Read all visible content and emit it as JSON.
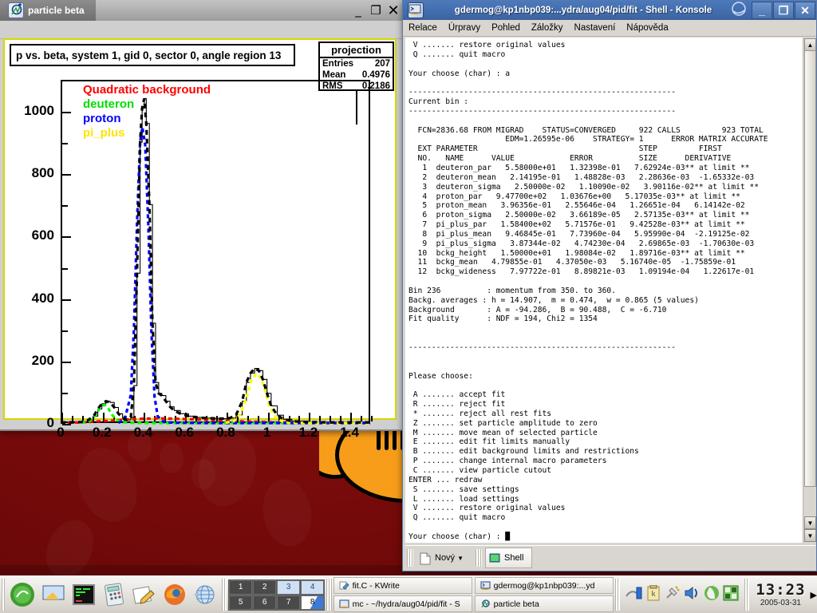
{
  "desktop": {
    "bg_color": "#7a0b0b",
    "accent_color": "#f79d1a"
  },
  "root_window": {
    "tab_label": "particle beta",
    "app_icon": "root-icon",
    "buttons": {
      "minimize": "_",
      "maximize": "❐",
      "close": "✕"
    }
  },
  "chart_data": {
    "type": "line",
    "title": "p vs. beta, system 1, gid 0, sector 0, angle region 13",
    "xlabel": "",
    "ylabel": "",
    "xlim": [
      0,
      1.5
    ],
    "ylim": [
      0,
      1100
    ],
    "xticks": [
      0,
      0.2,
      0.4,
      0.6,
      0.8,
      1,
      1.2,
      1.4
    ],
    "xtick_labels": [
      "0",
      "0.2",
      "0.4",
      "0.6",
      "0.8",
      "1",
      "1.2",
      "1.4"
    ],
    "yticks": [
      0,
      200,
      400,
      600,
      800,
      1000
    ],
    "ytick_labels": [
      "0",
      "200",
      "400",
      "600",
      "800",
      "1000"
    ],
    "grid": false,
    "legend_position": "top-left",
    "legend": [
      {
        "label": "Quadratic background",
        "color": "#ff0000"
      },
      {
        "label": "deuteron",
        "color": "#00ff00"
      },
      {
        "label": "proton",
        "color": "#0000ff"
      },
      {
        "label": "pi_plus",
        "color": "#ffff00"
      }
    ],
    "series": [
      {
        "name": "data",
        "color": "#000000",
        "x": [
          0.0,
          0.05,
          0.1,
          0.13,
          0.16,
          0.18,
          0.2,
          0.22,
          0.24,
          0.26,
          0.28,
          0.3,
          0.32,
          0.34,
          0.355,
          0.37,
          0.385,
          0.395,
          0.405,
          0.415,
          0.43,
          0.445,
          0.46,
          0.475,
          0.49,
          0.51,
          0.53,
          0.55,
          0.58,
          0.62,
          0.66,
          0.7,
          0.74,
          0.78,
          0.82,
          0.85,
          0.88,
          0.9,
          0.92,
          0.94,
          0.96,
          0.98,
          1.0,
          1.02,
          1.05,
          1.08,
          1.12,
          1.2,
          1.3,
          1.4,
          1.5
        ],
        "y": [
          2,
          2,
          3,
          8,
          22,
          45,
          62,
          70,
          66,
          50,
          30,
          16,
          10,
          18,
          120,
          480,
          900,
          1010,
          1040,
          960,
          700,
          320,
          130,
          95,
          88,
          70,
          52,
          40,
          30,
          22,
          18,
          16,
          15,
          14,
          16,
          26,
          70,
          130,
          160,
          175,
          168,
          140,
          95,
          55,
          25,
          12,
          6,
          3,
          2,
          2,
          2
        ]
      },
      {
        "name": "Quadratic background",
        "color": "#ff0000",
        "x": [
          0.0,
          0.1,
          0.2,
          0.3,
          0.4,
          0.48,
          0.55,
          0.65,
          0.75,
          0.85,
          0.95,
          1.05,
          1.15,
          1.3,
          1.5
        ],
        "y": [
          1,
          2,
          6,
          10,
          14,
          15,
          14,
          12,
          9,
          6,
          4,
          2,
          1,
          1,
          1
        ]
      },
      {
        "name": "deuteron",
        "color": "#00ff00",
        "x": [
          0.1,
          0.14,
          0.17,
          0.19,
          0.21,
          0.214,
          0.23,
          0.25,
          0.27,
          0.3,
          0.34,
          0.4,
          0.6,
          1.0,
          1.5
        ],
        "y": [
          1,
          6,
          26,
          48,
          58,
          58,
          48,
          26,
          10,
          3,
          1,
          0,
          0,
          0,
          0
        ]
      },
      {
        "name": "proton",
        "color": "#0000ff",
        "x": [
          0.28,
          0.31,
          0.34,
          0.355,
          0.37,
          0.385,
          0.396,
          0.41,
          0.425,
          0.44,
          0.455,
          0.47,
          0.5,
          0.55,
          0.7,
          1.0,
          1.5
        ],
        "y": [
          1,
          10,
          90,
          300,
          640,
          900,
          948,
          890,
          630,
          290,
          85,
          22,
          3,
          1,
          0,
          0,
          0
        ]
      },
      {
        "name": "pi_plus",
        "color": "#ffff00",
        "x": [
          0.8,
          0.84,
          0.87,
          0.9,
          0.925,
          0.947,
          0.97,
          0.99,
          1.01,
          1.04,
          1.07,
          1.1,
          1.2,
          1.5
        ],
        "y": [
          1,
          6,
          28,
          80,
          138,
          158,
          145,
          105,
          58,
          20,
          6,
          2,
          0,
          0
        ]
      }
    ],
    "stats_box": {
      "title": "projection",
      "rows": [
        {
          "label": "Entries",
          "value": "207"
        },
        {
          "label": "Mean",
          "value": "0.4976"
        },
        {
          "label": "RMS",
          "value": "0.2186"
        }
      ]
    }
  },
  "konsole": {
    "title": "gdermog@kp1nbp039:...ydra/aug04/pid/fit - Shell - Konsole",
    "menu": [
      "Relace",
      "Úrpravy",
      "Pohled",
      "Záložky",
      "Nastavení",
      "Nápověda"
    ],
    "buttons": {
      "minimize": "_",
      "maximize": "❐",
      "close": "✕"
    },
    "tabs": [
      {
        "label": "Nový",
        "icon": "new-document-icon",
        "active": false
      },
      {
        "label": "Shell",
        "icon": "shell-icon",
        "active": true
      }
    ],
    "scrollbar": {
      "up": "▲",
      "down": "▼"
    },
    "terminal_text": " V ....... restore original values\n Q ....... quit macro\n\nYour choose (char) : a\n\n----------------------------------------------------------\nCurrent bin :\n----------------------------------------------------------\n\n  FCN=2836.68 FROM MIGRAD    STATUS=CONVERGED     922 CALLS         923 TOTAL\n                     EDM=1.26595e-06    STRATEGY= 1      ERROR MATRIX ACCURATE\n  EXT PARAMETER                                   STEP         FIRST\n  NO.   NAME      VALUE            ERROR          SIZE      DERIVATIVE\n   1  deuteron_par   5.58000e+01   1.32398e-01   7.62924e-03** at limit **\n   2  deuteron_mean   2.14195e-01   1.48828e-03   2.28636e-03  -1.65332e-03\n   3  deuteron_sigma   2.50000e-02   1.10090e-02   3.90116e-02** at limit **\n   4  proton_par   9.47700e+02   1.03676e+00   5.17035e-03** at limit **\n   5  proton_mean   3.96356e-01   2.55646e-04   1.26651e-04   6.14142e-02\n   6  proton_sigma   2.50000e-02   3.66189e-05   2.57135e-03** at limit **\n   7  pi_plus_par   1.58400e+02   5.71576e-01   9.42528e-03** at limit **\n   8  pi_plus_mean   9.46845e-01   7.73960e-04   5.95990e-04  -2.19125e-02\n   9  pi_plus_sigma   3.87344e-02   4.74230e-04   2.69865e-03  -1.70630e-03\n  10  bckg_height   1.50000e+01   1.98084e-02   1.89716e-03** at limit **\n  11  bckg_mean   4.79855e-01   4.37050e-03   5.16740e-05  -1.75859e-01\n  12  bckg_wideness   7.97722e-01   8.89821e-03   1.09194e-04   1.22617e-01\n\nBin 236          : momentum from 350. to 360.\nBackg. averages : h = 14.907,  m = 0.474,  w = 0.865 (5 values)\nBackground       : A = -94.286,  B = 90.488,  C = -6.710\nFit quality      : NDF = 194, Chi2 = 1354\n\n\n----------------------------------------------------------\n\n\nPlease choose:\n\n A ....... accept fit\n R ....... reject fit\n * ....... reject all rest fits\n Z ....... set particle amplitude to zero\n M ....... move mean of selected particle\n E ....... edit fit limits manually\n B ....... edit background limits and restrictions\n P ....... change internal macro parameters\n C ....... view particle cutout\nENTER ... redraw\n S ....... save settings\n L ....... load settings\n V ....... restore original values\n Q ....... quit macro\n\nYour choose (char) : █"
  },
  "taskbar": {
    "launchers": [
      {
        "name": "kmenu-icon",
        "label": "K Menu"
      },
      {
        "name": "show-desktop-icon",
        "label": "Show Desktop"
      },
      {
        "name": "terminal-icon",
        "label": "Terminal"
      },
      {
        "name": "calculator-icon",
        "label": "Calculator"
      },
      {
        "name": "editor-icon",
        "label": "Text Editor"
      },
      {
        "name": "firefox-icon",
        "label": "Firefox"
      },
      {
        "name": "browser-icon",
        "label": "Web Browser"
      }
    ],
    "pager": [
      "1",
      "2",
      "3",
      "4",
      "5",
      "6",
      "7",
      "8"
    ],
    "pager_current": "8",
    "tasks": [
      {
        "label": "fit.C - KWrite",
        "icon": "kwrite-icon"
      },
      {
        "label": "gdermog@kp1nbp039:...yd",
        "icon": "konsole-icon"
      },
      {
        "label": "mc - ~/hydra/aug04/pid/fit - S",
        "icon": "kwrite-icon"
      },
      {
        "label": "particle beta",
        "icon": "root-icon"
      }
    ],
    "tray": [
      {
        "name": "network-icon"
      },
      {
        "name": "klipper-icon"
      },
      {
        "name": "power-plug-icon"
      },
      {
        "name": "volume-icon"
      },
      {
        "name": "battery-icon"
      },
      {
        "name": "desktop-preview-icon"
      }
    ],
    "clock": {
      "time": "13:23",
      "date": "2005-03-31"
    },
    "expand_arrow": "▶"
  }
}
